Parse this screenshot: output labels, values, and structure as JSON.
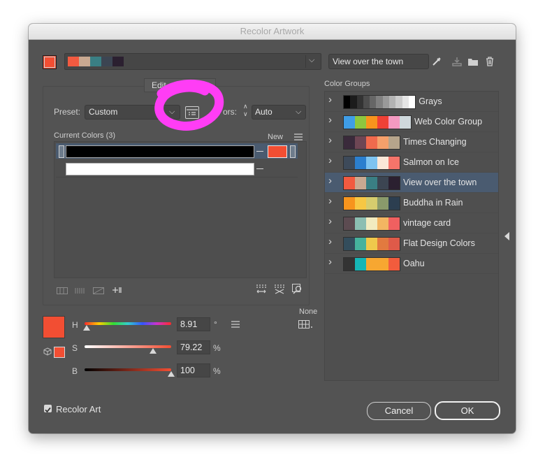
{
  "window": {
    "title": "Recolor Artwork"
  },
  "colors": {
    "primary": "#f24e33",
    "accent_sel": "#4a5b70",
    "highlight": "#ff3df5"
  },
  "top": {
    "group_name_value": "View over the town",
    "swatches": [
      "#f25a40",
      "#c9a991",
      "#3a7f84",
      "#3c4552",
      "#2b2030"
    ]
  },
  "tabs": {
    "edit_label": "Edit"
  },
  "preset": {
    "label": "Preset:",
    "value": "Custom",
    "colors_label": "ors:",
    "colors_value": "Auto"
  },
  "current_colors": {
    "label": "Current Colors (3)",
    "new_label": "New",
    "rows": [
      {
        "current": "#000000",
        "new": "#f24e33"
      },
      {
        "current": "#ffffff",
        "new": ""
      }
    ]
  },
  "hsb": {
    "h_label": "H",
    "h_value": "8.91",
    "h_unit": "°",
    "s_label": "S",
    "s_value": "79.22",
    "s_unit": "%",
    "b_label": "B",
    "b_value": "100",
    "b_unit": "%",
    "h_fraction": 0.025,
    "s_fraction": 0.7922,
    "b_fraction": 1.0
  },
  "none_label": "None",
  "color_groups": {
    "label": "Color Groups",
    "items": [
      {
        "name": "Grays",
        "swatches": [
          "#000000",
          "#1c1c1c",
          "#333333",
          "#4d4d4d",
          "#666666",
          "#808080",
          "#999999",
          "#b3b3b3",
          "#cccccc",
          "#e6e6e6",
          "#ffffff"
        ]
      },
      {
        "name": "Web Color Group",
        "swatches": [
          "#3f9de6",
          "#8dc63f",
          "#f7941d",
          "#ef4136",
          "#f49ac1",
          "#cfd8dc"
        ]
      },
      {
        "name": "Times Changing",
        "swatches": [
          "#3a2a3b",
          "#6e4654",
          "#f06a4d",
          "#f5a06b",
          "#b6a48b"
        ]
      },
      {
        "name": "Salmon on Ice",
        "swatches": [
          "#3d4a5a",
          "#2b7fcf",
          "#7ec3f0",
          "#fbe7d7",
          "#f5746a"
        ]
      },
      {
        "name": "View over the town",
        "swatches": [
          "#f25a40",
          "#c9a991",
          "#3a7f84",
          "#3c4552",
          "#2b2030"
        ]
      },
      {
        "name": "Buddha in Rain",
        "swatches": [
          "#f7941d",
          "#f7c744",
          "#d6cc6e",
          "#8a9a6b",
          "#2c3e50"
        ]
      },
      {
        "name": "vintage card",
        "swatches": [
          "#5c4b51",
          "#8cbeb2",
          "#f2ebbf",
          "#f3b562",
          "#f06060"
        ]
      },
      {
        "name": "Flat Design Colors",
        "swatches": [
          "#334d5c",
          "#45b29d",
          "#efc94c",
          "#e27a3f",
          "#df5a49"
        ]
      },
      {
        "name": "Oahu",
        "swatches": [
          "#333333",
          "#16b6b6",
          "#f7a731",
          "#f7a731",
          "#f25c3d"
        ]
      }
    ],
    "selected_index": 4
  },
  "footer": {
    "recolor_art_label": "Recolor Art",
    "recolor_art_checked": true,
    "cancel_label": "Cancel",
    "ok_label": "OK"
  }
}
